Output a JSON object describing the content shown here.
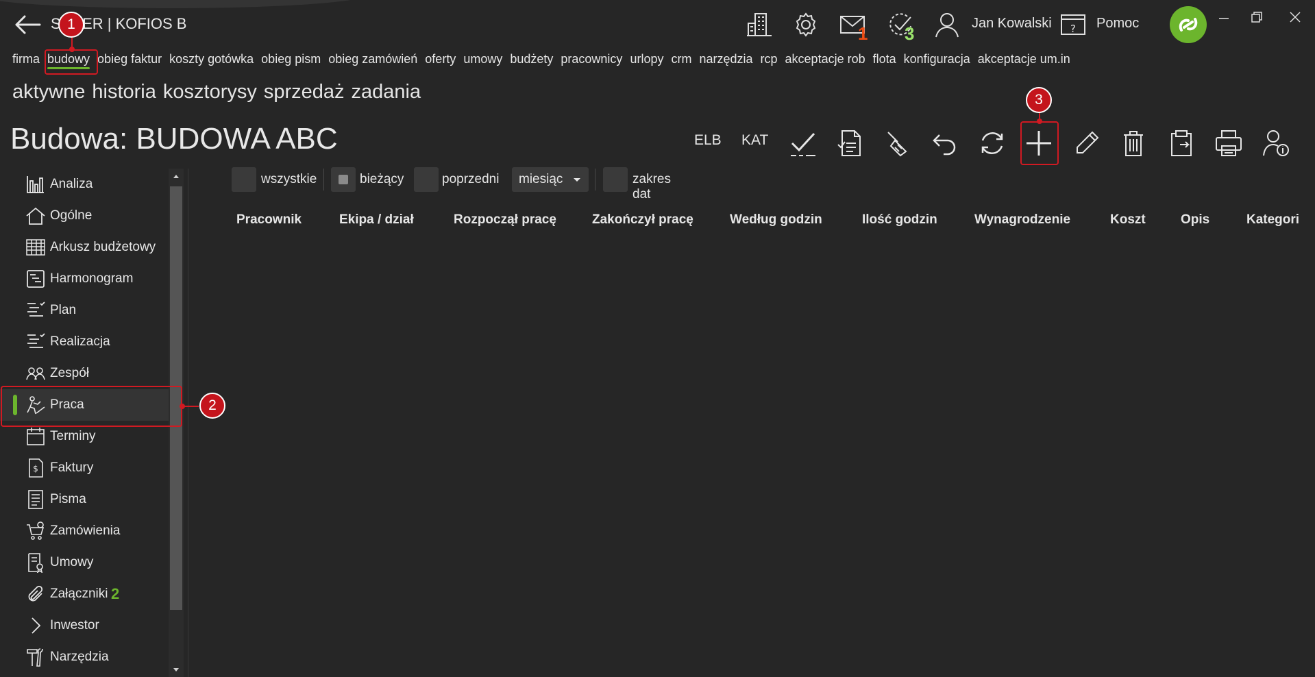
{
  "app": {
    "title": "SILVER | KOFIOS B",
    "user": "Jan Kowalski",
    "help": "Pomoc"
  },
  "badges": {
    "mail_count": "1",
    "tasks_count": "3",
    "attachments_count": "2"
  },
  "main_nav": [
    "firma",
    "budowy",
    "obieg faktur",
    "koszty gotówka",
    "obieg pism",
    "obieg zamówień",
    "oferty",
    "umowy",
    "budżety",
    "pracownicy",
    "urlopy",
    "crm",
    "narzędzia",
    "rcp",
    "akceptacje rob",
    "flota",
    "konfiguracja",
    "akceptacje um.in"
  ],
  "sub_nav": [
    "aktywne",
    "historia",
    "kosztorysy",
    "sprzedaż",
    "zadania"
  ],
  "page": {
    "title": "Budowa: BUDOWA ABC"
  },
  "toolbar": {
    "elb": "ELB",
    "kat": "KAT"
  },
  "sidebar": [
    {
      "label": "Analiza",
      "icon": "bar-chart-icon"
    },
    {
      "label": "Ogólne",
      "icon": "home-icon"
    },
    {
      "label": "Arkusz budżetowy",
      "icon": "spreadsheet-icon"
    },
    {
      "label": "Harmonogram",
      "icon": "schedule-icon"
    },
    {
      "label": "Plan",
      "icon": "checklist-icon"
    },
    {
      "label": "Realizacja",
      "icon": "checklist-icon"
    },
    {
      "label": "Zespół",
      "icon": "team-icon"
    },
    {
      "label": "Praca",
      "icon": "worker-icon"
    },
    {
      "label": "Terminy",
      "icon": "calendar-icon"
    },
    {
      "label": "Faktury",
      "icon": "invoice-icon"
    },
    {
      "label": "Pisma",
      "icon": "document-icon"
    },
    {
      "label": "Zamówienia",
      "icon": "cart-icon"
    },
    {
      "label": "Umowy",
      "icon": "contract-icon"
    },
    {
      "label": "Załączniki",
      "icon": "paperclip-icon"
    },
    {
      "label": "Inwestor",
      "icon": "chevron-right-icon"
    },
    {
      "label": "Narzędzia",
      "icon": "tools-icon"
    }
  ],
  "filters": {
    "all": "wszystkie",
    "current": "bieżący",
    "previous": "poprzedni",
    "period": "miesiąc",
    "range": "zakres dat"
  },
  "table": {
    "columns": [
      "Pracownik",
      "Ekipa / dział",
      "Rozpoczął pracę",
      "Zakończył pracę",
      "Według godzin",
      "Ilość godzin",
      "Wynagrodzenie",
      "Koszt",
      "Opis",
      "Kategori"
    ]
  },
  "callouts": [
    "1",
    "2",
    "3"
  ],
  "colors": {
    "accent": "#6cb52d",
    "badge_mail": "#f04d13",
    "badge_tasks": "#9be36c",
    "callout": "#c4141c",
    "background": "#262626"
  }
}
